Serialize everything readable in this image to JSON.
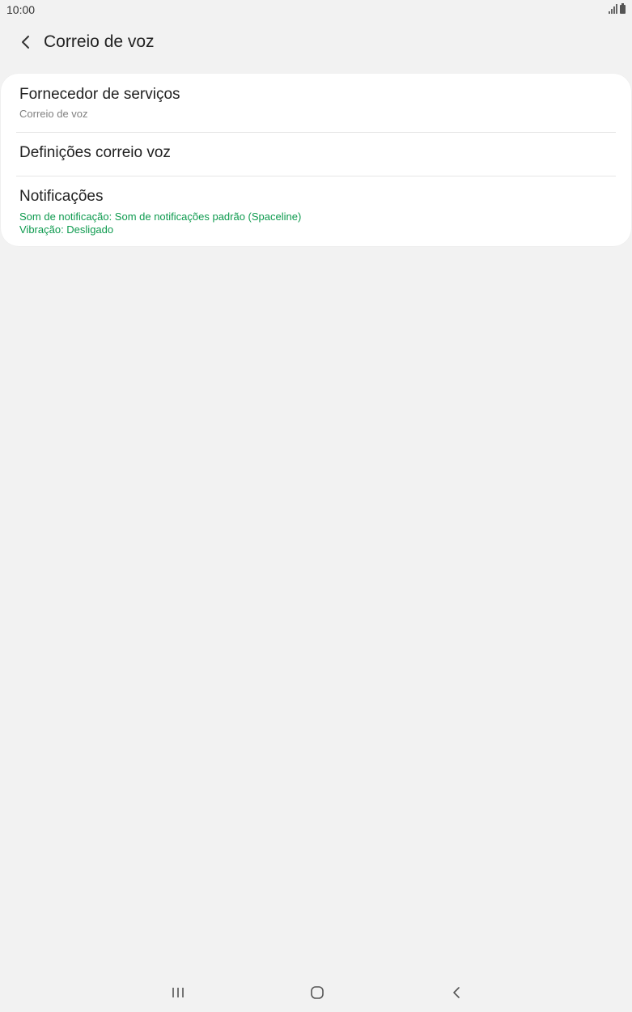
{
  "status_bar": {
    "time": "10:00",
    "icons": [
      "signal-icon",
      "battery-icon"
    ]
  },
  "header": {
    "back_icon": "chevron-left-icon",
    "title": "Correio de voz"
  },
  "settings": {
    "items": [
      {
        "title": "Fornecedor de serviços",
        "subtitle": "Correio de voz"
      },
      {
        "title": "Definições correio voz"
      },
      {
        "title": "Notificações",
        "subtitle_lines": [
          "Som de notificação: Som de notificações padrão (Spaceline)",
          "Vibração: Desligado"
        ]
      }
    ]
  },
  "nav_bar": {
    "icons": [
      "recent-apps-icon",
      "home-icon",
      "back-icon"
    ]
  },
  "colors": {
    "background": "#f2f2f2",
    "card": "#ffffff",
    "accent_green": "#0d9a4e",
    "secondary_text": "#808080"
  }
}
